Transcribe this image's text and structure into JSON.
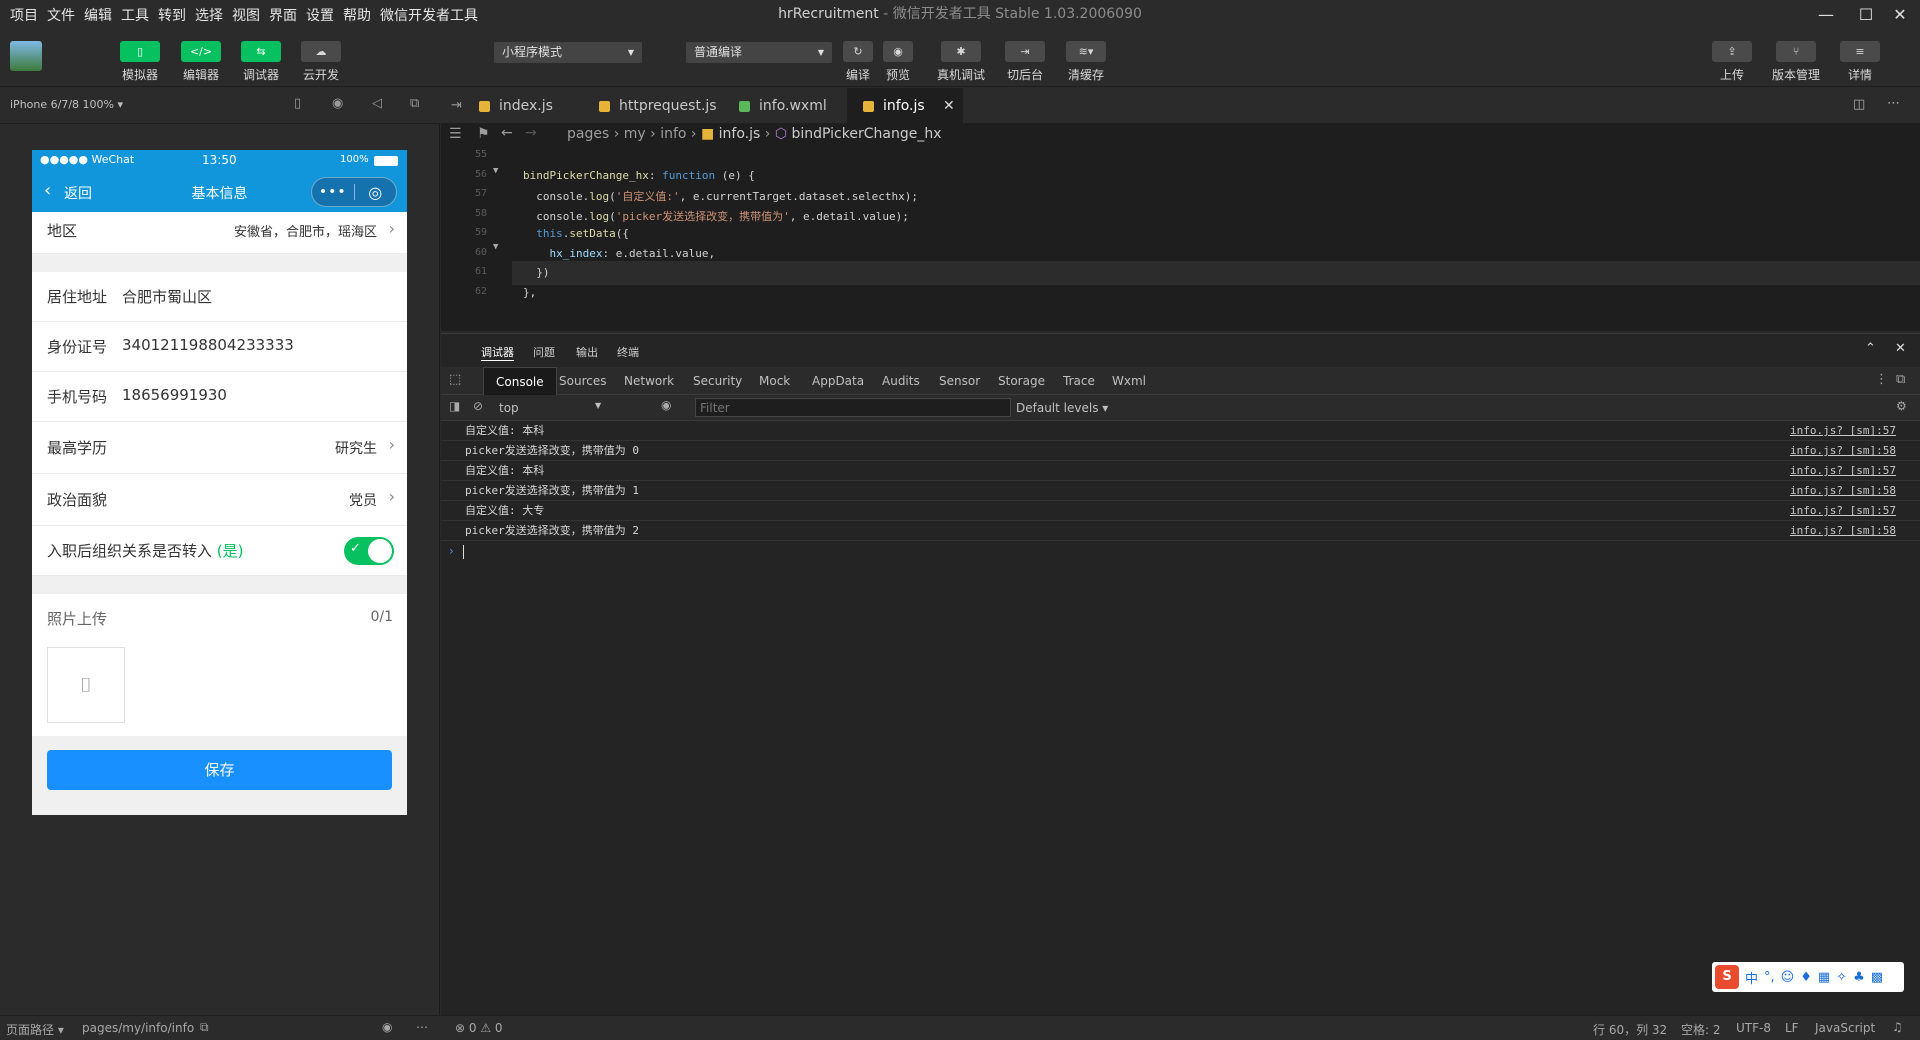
{
  "menu": [
    "项目",
    "文件",
    "编辑",
    "工具",
    "转到",
    "选择",
    "视图",
    "界面",
    "设置",
    "帮助",
    "微信开发者工具"
  ],
  "window": {
    "app": "hrRecruitment",
    "subtitle": "- 微信开发者工具 Stable 1.03.2006090"
  },
  "toolbar": {
    "left": [
      "模拟器",
      "编辑器",
      "调试器",
      "云开发"
    ],
    "mode_select": "小程序模式",
    "compile_select": "普通编译",
    "middle": [
      "编译",
      "预览",
      "真机调试",
      "切后台",
      "清缓存"
    ],
    "right": [
      "上传",
      "版本管理",
      "详情"
    ]
  },
  "simulator": {
    "device": "iPhone 6/7/8 100% ▾",
    "status": {
      "carrier": "●●●●● WeChat",
      "time": "13:50",
      "battery": "100%"
    },
    "nav": {
      "back": "返回",
      "title": "基本信息"
    },
    "form": {
      "region": {
        "label": "地区",
        "value": "安徽省，合肥市，瑶海区"
      },
      "address": {
        "label": "居住地址",
        "value": "合肥市蜀山区"
      },
      "idcard": {
        "label": "身份证号",
        "value": "340121198804233333"
      },
      "phone": {
        "label": "手机号码",
        "value": "18656991930"
      },
      "education": {
        "label": "最高学历",
        "value": "研究生"
      },
      "politics": {
        "label": "政治面貌",
        "value": "党员"
      },
      "transfer": {
        "label": "入职后组织关系是否转入",
        "value": "(是)"
      },
      "photo": {
        "label": "照片上传",
        "count": "0/1"
      },
      "save": "保存"
    },
    "footer": {
      "path_label": "页面路径 ▾",
      "path": "pages/my/info/info"
    }
  },
  "editor": {
    "tabs": [
      {
        "name": "index.js",
        "color": "#e8b339"
      },
      {
        "name": "httprequest.js",
        "color": "#e8b339"
      },
      {
        "name": "info.wxml",
        "color": "#5bb75b"
      },
      {
        "name": "info.js",
        "color": "#e8b339"
      }
    ],
    "breadcrumb": {
      "p1": "pages",
      "p2": "my",
      "p3": "info",
      "p4": "info.js",
      "p5": "bindPickerChange_hx"
    },
    "lines": [
      {
        "n": "55",
        "parts": []
      },
      {
        "n": "56",
        "parts": [
          {
            "c": "fn",
            "t": "bindPickerChange_hx"
          },
          {
            "c": "",
            "t": ": "
          },
          {
            "c": "kw",
            "t": "function"
          },
          {
            "c": "",
            "t": " (e) {"
          }
        ]
      },
      {
        "n": "57",
        "parts": [
          {
            "c": "",
            "t": "  console."
          },
          {
            "c": "fn",
            "t": "log"
          },
          {
            "c": "",
            "t": "("
          },
          {
            "c": "st",
            "t": "'自定义值:'"
          },
          {
            "c": "",
            "t": ", e.currentTarget.dataset.selecthx);"
          }
        ]
      },
      {
        "n": "58",
        "parts": [
          {
            "c": "",
            "t": "  console."
          },
          {
            "c": "fn",
            "t": "log"
          },
          {
            "c": "",
            "t": "("
          },
          {
            "c": "st",
            "t": "'picker发送选择改变，携带值为'"
          },
          {
            "c": "",
            "t": ", e.detail.value);"
          }
        ]
      },
      {
        "n": "59",
        "parts": [
          {
            "c": "",
            "t": "  "
          },
          {
            "c": "kw",
            "t": "this"
          },
          {
            "c": "",
            "t": "."
          },
          {
            "c": "fn",
            "t": "setData"
          },
          {
            "c": "",
            "t": "({"
          }
        ]
      },
      {
        "n": "60",
        "parts": [
          {
            "c": "pr",
            "t": "    hx_index"
          },
          {
            "c": "",
            "t": ": e.detail.value,"
          }
        ]
      },
      {
        "n": "61",
        "parts": [
          {
            "c": "",
            "t": "  })"
          }
        ]
      },
      {
        "n": "62",
        "parts": [
          {
            "c": "",
            "t": "},"
          }
        ]
      }
    ]
  },
  "devtools": {
    "panel_tabs": [
      "调试器",
      "问题",
      "输出",
      "终端"
    ],
    "tabs": [
      "Console",
      "Sources",
      "Network",
      "Security",
      "Mock",
      "AppData",
      "Audits",
      "Sensor",
      "Storage",
      "Trace",
      "Wxml"
    ],
    "context": "top",
    "filter_placeholder": "Filter",
    "levels": "Default levels ▾",
    "logs": [
      {
        "msg": "自定义值: 本科",
        "src": "info.js? [sm]:57"
      },
      {
        "msg": "picker发送选择改变，携带值为 0",
        "src": "info.js? [sm]:58"
      },
      {
        "msg": "自定义值: 本科",
        "src": "info.js? [sm]:57"
      },
      {
        "msg": "picker发送选择改变，携带值为 1",
        "src": "info.js? [sm]:58"
      },
      {
        "msg": "自定义值: 大专",
        "src": "info.js? [sm]:57"
      },
      {
        "msg": "picker发送选择改变，携带值为 2",
        "src": "info.js? [sm]:58"
      }
    ]
  },
  "statusbar": {
    "problems": "⊗ 0 ⚠ 0",
    "position": "行 60，列 32",
    "spaces": "空格: 2",
    "encoding": "UTF-8",
    "eol": "LF",
    "language": "JavaScript"
  },
  "ime": {
    "label": "中"
  }
}
